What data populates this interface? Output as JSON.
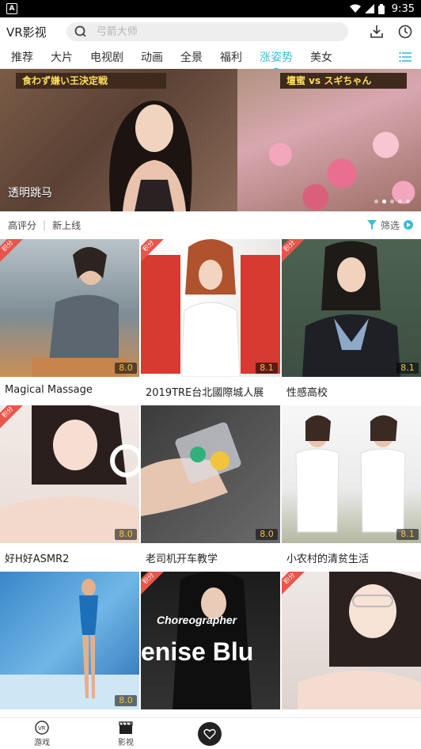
{
  "statusbar": {
    "time": "9:35",
    "app_icon_letter": "A"
  },
  "header": {
    "title": "VR影视",
    "search_placeholder": "弓箭大师"
  },
  "tabs": [
    "推荐",
    "大片",
    "电视剧",
    "动画",
    "全景",
    "福利",
    "涨姿势",
    "美女"
  ],
  "active_tab_index": 6,
  "banner": {
    "caption": "透明跳马",
    "sign_left": "食わず嫌い王決定戦",
    "sign_right": "壇蜜 vs スギちゃん"
  },
  "filters": {
    "top_rated": "高评分",
    "new": "新上线",
    "filter_label": "筛选"
  },
  "cards": [
    {
      "title": "Magical Massage",
      "score": "8.0",
      "badge": "积分"
    },
    {
      "title": "2019TRE台北國際城人展",
      "score": "8.1",
      "badge": "积分"
    },
    {
      "title": "性感高校",
      "score": "8.1",
      "badge": "积分"
    },
    {
      "title": "好H好ASMR2",
      "score": "8.0",
      "badge": "积分"
    },
    {
      "title": "老司机开车教学",
      "score": "8.0",
      "badge": ""
    },
    {
      "title": "小农村的清贫生活",
      "score": "8.1",
      "badge": ""
    },
    {
      "title": "",
      "score": "8.0",
      "badge": ""
    },
    {
      "title": "",
      "score": "",
      "badge": "积分",
      "overlay_line1": "Choreographer",
      "overlay_line2": "enise Blu"
    },
    {
      "title": "",
      "score": "",
      "badge": "积分"
    }
  ],
  "bottom_nav": {
    "games": "游戏",
    "movies": "影视"
  },
  "colors": {
    "accent": "#3bbcd9",
    "badge": "#e8554a",
    "score": "#f1c14a"
  }
}
